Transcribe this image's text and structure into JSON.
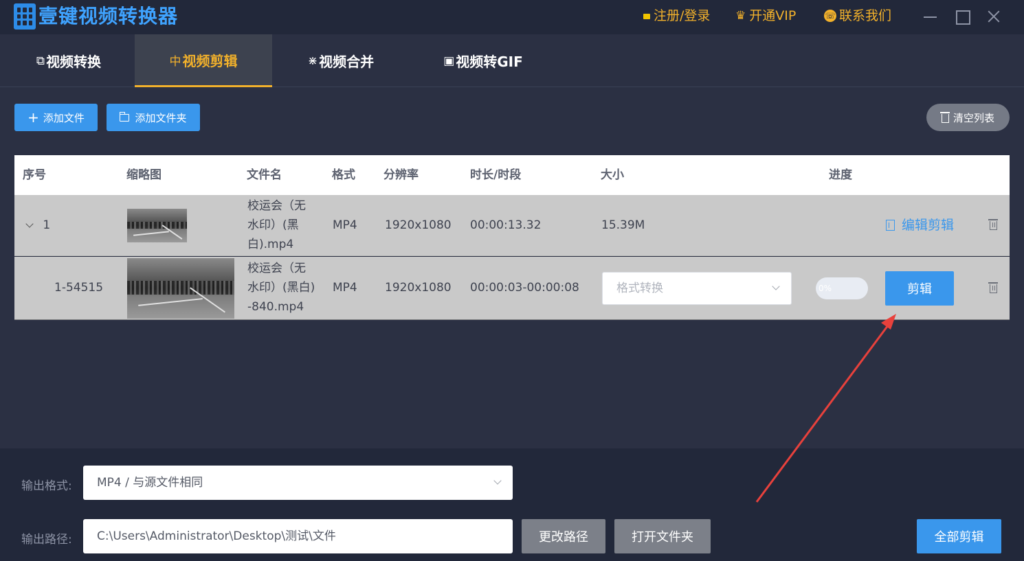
{
  "titlebar": {
    "app_title": "壹键视频转换器",
    "register_login": "注册/登录",
    "vip": "开通VIP",
    "contact": "联系我们"
  },
  "tabs": [
    {
      "label": "视频转换",
      "active": false
    },
    {
      "label": "视频剪辑",
      "active": true
    },
    {
      "label": "视频合并",
      "active": false
    },
    {
      "label": "视频转GIF",
      "active": false
    }
  ],
  "toolbar": {
    "add_file": "添加文件",
    "add_folder": "添加文件夹",
    "clear_list": "清空列表"
  },
  "table": {
    "headers": [
      "序号",
      "缩略图",
      "文件名",
      "格式",
      "分辨率",
      "时长/时段",
      "大小",
      "进度"
    ],
    "rows": [
      {
        "index": "1",
        "filename_lines": [
          "校运会（无",
          "水印）(黑",
          "白).mp4"
        ],
        "format": "MP4",
        "resolution": "1920x1080",
        "duration": "00:00:13.32",
        "size": "15.39M",
        "action": "编辑剪辑"
      },
      {
        "index": "1-54515",
        "filename_lines": [
          "校运会（无",
          "水印）(黑白)",
          "-840.mp4"
        ],
        "format": "MP4",
        "resolution": "1920x1080",
        "duration": "00:00:03-00:00:08",
        "format_placeholder": "格式转换",
        "progress_text": "0%",
        "progress": 0,
        "action": "剪辑"
      }
    ]
  },
  "bottom": {
    "output_format_label": "输出格式:",
    "output_format_value": "MP4 / 与源文件相同",
    "output_path_label": "输出路径:",
    "output_path_value": "C:\\Users\\Administrator\\Desktop\\测试\\文件",
    "change_path": "更改路径",
    "open_folder": "打开文件夹",
    "clip_all": "全部剪辑"
  },
  "colors": {
    "accent": "#3a97ec",
    "active_tab": "#f2b12b",
    "annotation_arrow": "#e8413c"
  }
}
